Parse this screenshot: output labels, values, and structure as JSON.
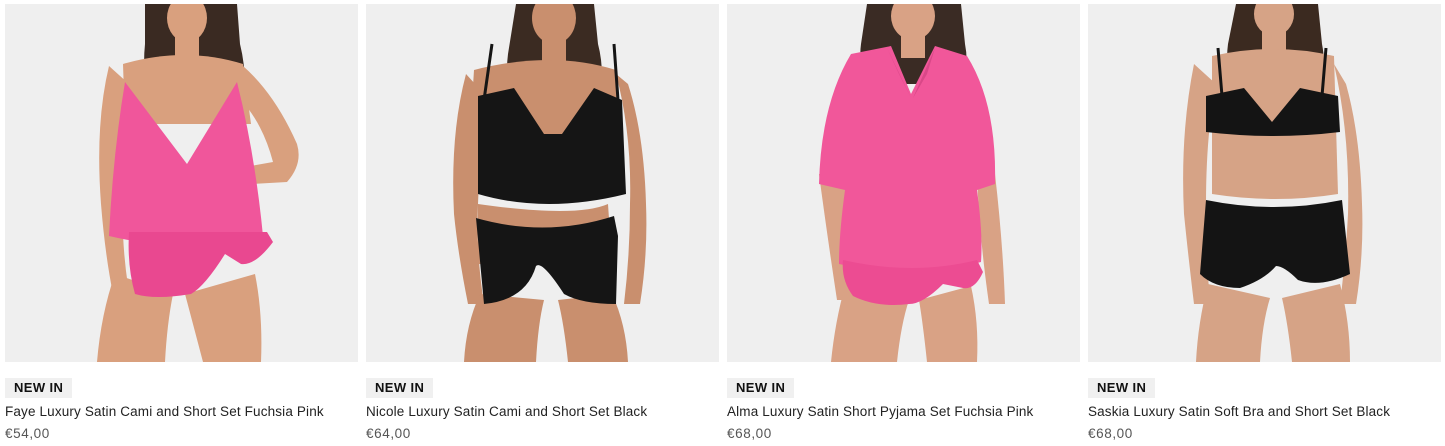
{
  "products": [
    {
      "badge": "NEW IN",
      "title": "Faye Luxury Satin Cami and Short Set Fuchsia Pink",
      "price": "€54,00",
      "garment_color": "#f0569b",
      "skin_color": "#d9a07e",
      "hair_color": "#3a2a22",
      "style": "cami-short"
    },
    {
      "badge": "NEW IN",
      "title": "Nicole Luxury Satin Cami and Short Set Black",
      "price": "€64,00",
      "garment_color": "#151515",
      "skin_color": "#c98f6e",
      "hair_color": "#3b2b22",
      "style": "tie-cami-short"
    },
    {
      "badge": "NEW IN",
      "title": "Alma Luxury Satin Short Pyjama Set Fuchsia Pink",
      "price": "€68,00",
      "garment_color": "#f1579a",
      "skin_color": "#d9a285",
      "hair_color": "#3a2b24",
      "style": "shirt-short"
    },
    {
      "badge": "NEW IN",
      "title": "Saskia Luxury Satin Soft Bra and Short Set Black",
      "price": "€68,00",
      "garment_color": "#141414",
      "skin_color": "#d6a386",
      "hair_color": "#3b2a20",
      "style": "bra-short"
    }
  ]
}
